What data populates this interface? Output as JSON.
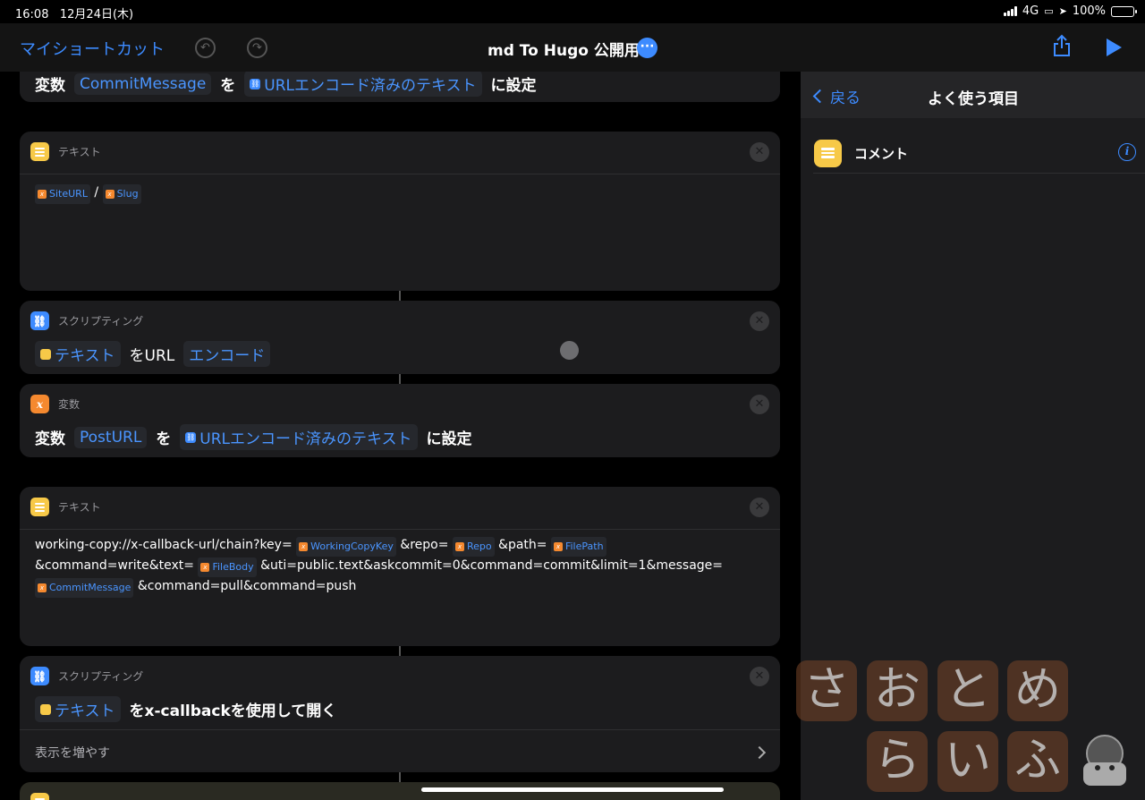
{
  "status_bar": {
    "time": "16:08",
    "date": "12月24日(木)",
    "network": "4G",
    "battery": "100%"
  },
  "nav": {
    "back": "マイショートカット",
    "title": "md To Hugo 公開用"
  },
  "actions": {
    "set_commit": {
      "prefix": "変数",
      "var": "CommitMessage",
      "particle": "を",
      "value": "URLエンコード済みのテキスト",
      "suffix": "に設定"
    },
    "text1": {
      "header": "テキスト",
      "var1": "SiteURL",
      "sep": "/",
      "var2": "Slug"
    },
    "encode": {
      "header": "スクリプティング",
      "input": "テキスト",
      "mid": "をURL",
      "mode": "エンコード"
    },
    "set_post": {
      "header": "変数",
      "prefix": "変数",
      "var": "PostURL",
      "particle": "を",
      "value": "URLエンコード済みのテキスト",
      "suffix": "に設定"
    },
    "text2": {
      "header": "テキスト",
      "p1": "working-copy://x-callback-url/chain?key=",
      "v1": "WorkingCopyKey",
      "p2": "&repo=",
      "v2": "Repo",
      "p3": "&path=",
      "v3": "FilePath",
      "p4": "&command=write&text=",
      "v4": "FileBody",
      "p5": "&uti=public.text&askcommit=0&command=commit&limit=1&message=",
      "v5": "CommitMessage",
      "p6": "&command=pull&command=push"
    },
    "open_xcb": {
      "header": "スクリプティング",
      "input": "テキスト",
      "rest": "をx-callbackを使用して開く",
      "more": "表示を増やす"
    }
  },
  "sidebar": {
    "back": "戻る",
    "title": "よく使う項目",
    "item": "コメント"
  },
  "watermark": [
    "さ",
    "お",
    "と",
    "め",
    "ら",
    "い",
    "ふ"
  ]
}
